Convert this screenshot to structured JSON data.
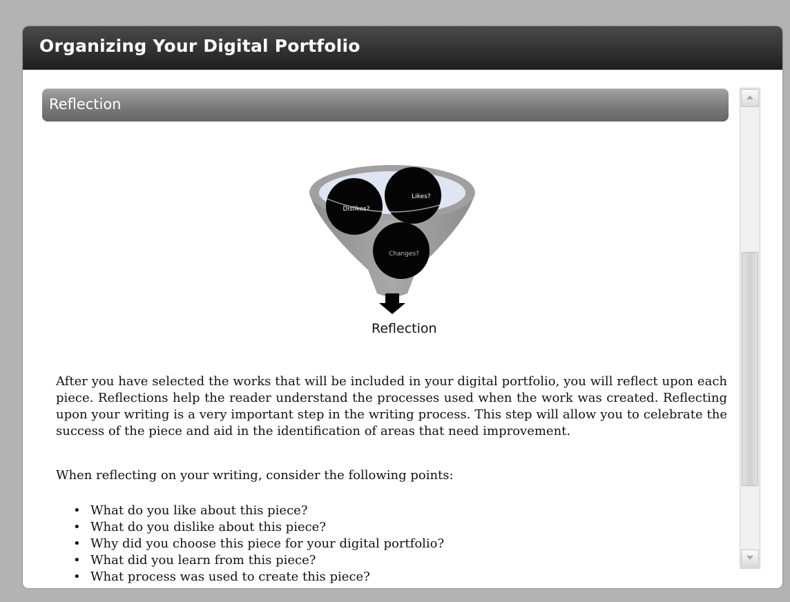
{
  "window": {
    "title": "Organizing Your Digital Portfolio"
  },
  "section": {
    "title": "Reflection"
  },
  "diagram": {
    "bubbles": [
      "Dislikes?",
      "Likes?",
      "Changes?"
    ],
    "caption": "Reflection"
  },
  "body": {
    "paragraph1": "After you have selected the works that will be included in your digital portfolio, you will reflect upon each piece. Reflections help the reader understand the processes used when the work was created. Reflecting upon your writing is a very important step in the writing process. This step will allow you to celebrate the success of the piece and aid in the identification of areas that need improvement.",
    "paragraph2": "When reflecting on your writing, consider the following points:",
    "bullet_symbol": "•",
    "bullets": [
      "What do you like about this piece?",
      "What do you dislike about this piece?",
      "Why did you choose this piece for your digital portfolio?",
      "What did you learn from this piece?",
      "What process was used to create this piece?"
    ]
  },
  "scrollbar": {
    "up_icon": "arrow-up-icon",
    "down_icon": "arrow-down-icon"
  },
  "colors": {
    "titlebar": "#2a2a2a",
    "section_header": "#7b7b7b",
    "funnel": "#9a9a9a",
    "funnel_rim_fill": "#dfe6f2",
    "bubble": "#050505"
  }
}
